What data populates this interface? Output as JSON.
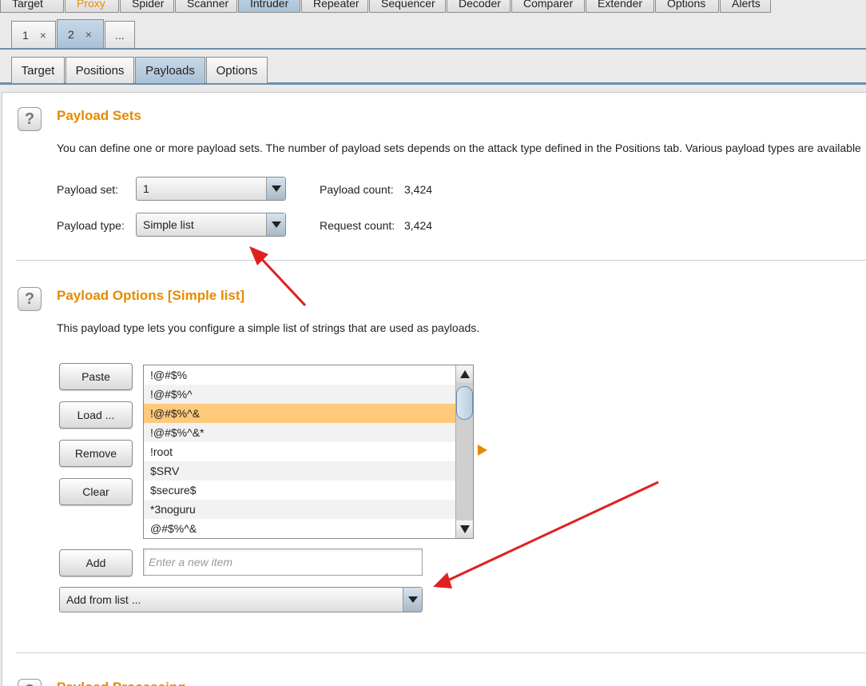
{
  "top_tabs": [
    {
      "label": "Target"
    },
    {
      "label": "Proxy"
    },
    {
      "label": "Spider"
    },
    {
      "label": "Scanner"
    },
    {
      "label": "Intruder"
    },
    {
      "label": "Repeater"
    },
    {
      "label": "Sequencer"
    },
    {
      "label": "Decoder"
    },
    {
      "label": "Comparer"
    },
    {
      "label": "Extender"
    },
    {
      "label": "Options"
    },
    {
      "label": "Alerts"
    }
  ],
  "instance_tabs": [
    {
      "label": "1",
      "close": "×"
    },
    {
      "label": "2",
      "close": "×"
    },
    {
      "label": "..."
    }
  ],
  "sub_tabs": [
    {
      "label": "Target"
    },
    {
      "label": "Positions"
    },
    {
      "label": "Payloads"
    },
    {
      "label": "Options"
    }
  ],
  "payload_sets": {
    "help": "?",
    "title": "Payload Sets",
    "description": "You can define one or more payload sets. The number of payload sets depends on the attack type defined in the Positions tab. Various payload types are available",
    "payload_set_label": "Payload set:",
    "payload_set_value": "1",
    "payload_type_label": "Payload type:",
    "payload_type_value": "Simple list",
    "payload_count_label": "Payload count:",
    "payload_count_value": "3,424",
    "request_count_label": "Request count:",
    "request_count_value": "3,424"
  },
  "payload_options": {
    "help": "?",
    "title": "Payload Options [Simple list]",
    "description": "This payload type lets you configure a simple list of strings that are used as payloads.",
    "buttons": {
      "paste": "Paste",
      "load": "Load ...",
      "remove": "Remove",
      "clear": "Clear",
      "add": "Add"
    },
    "list_items": [
      "!@#$%",
      "!@#$%^",
      "!@#$%^&",
      "!@#$%^&*",
      "!root",
      "$SRV",
      "$secure$",
      "*3noguru",
      "@#$%^&"
    ],
    "selected_index": 2,
    "new_item_placeholder": "Enter a new item",
    "add_from_list_value": "Add from list ..."
  },
  "payload_processing": {
    "title": "Payload Processing"
  },
  "colors": {
    "accent_orange": "#e58a00",
    "selected_row": "#ffc97c",
    "annotation_red": "#e02020"
  }
}
